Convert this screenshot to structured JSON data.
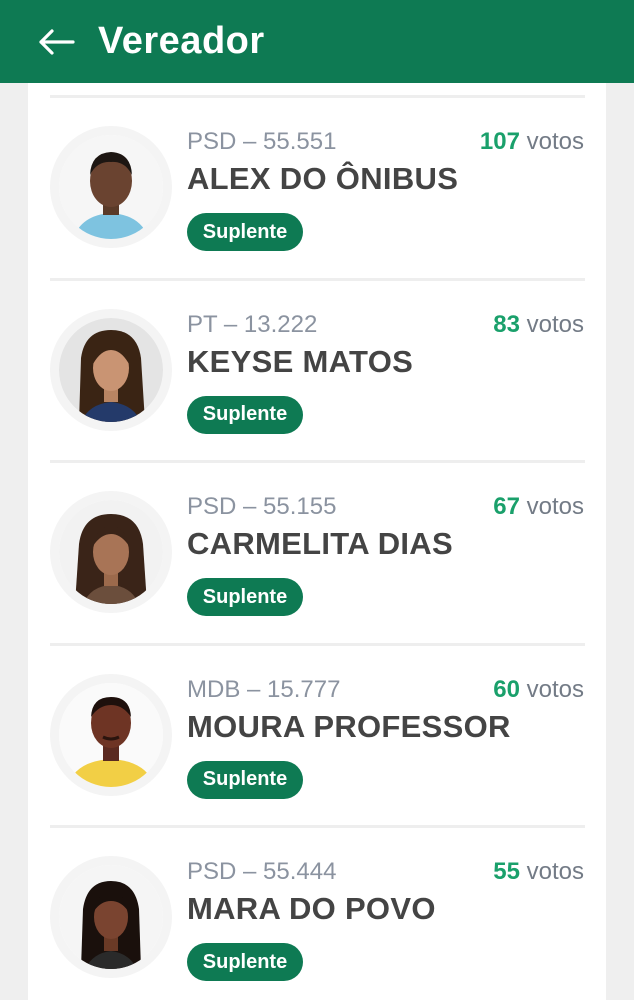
{
  "header": {
    "title": "Vereador",
    "back_icon": "arrow-left-icon",
    "background": "#0e7a53"
  },
  "candidates": [
    {
      "party_number": "PSD – 55.551",
      "name": "ALEX DO ÔNIBUS",
      "votes": "107",
      "votes_label": "votos",
      "status": "Suplente"
    },
    {
      "party_number": "PT – 13.222",
      "name": "KEYSE MATOS",
      "votes": "83",
      "votes_label": "votos",
      "status": "Suplente"
    },
    {
      "party_number": "PSD – 55.155",
      "name": "CARMELITA DIAS",
      "votes": "67",
      "votes_label": "votos",
      "status": "Suplente"
    },
    {
      "party_number": "MDB – 15.777",
      "name": "MOURA PROFESSOR",
      "votes": "60",
      "votes_label": "votos",
      "status": "Suplente"
    },
    {
      "party_number": "PSD – 55.444",
      "name": "MARA DO POVO",
      "votes": "55",
      "votes_label": "votos",
      "status": "Suplente"
    }
  ],
  "colors": {
    "accent": "#0e7a53",
    "votes_number": "#1aa06b",
    "party_text": "#8b93a0"
  }
}
